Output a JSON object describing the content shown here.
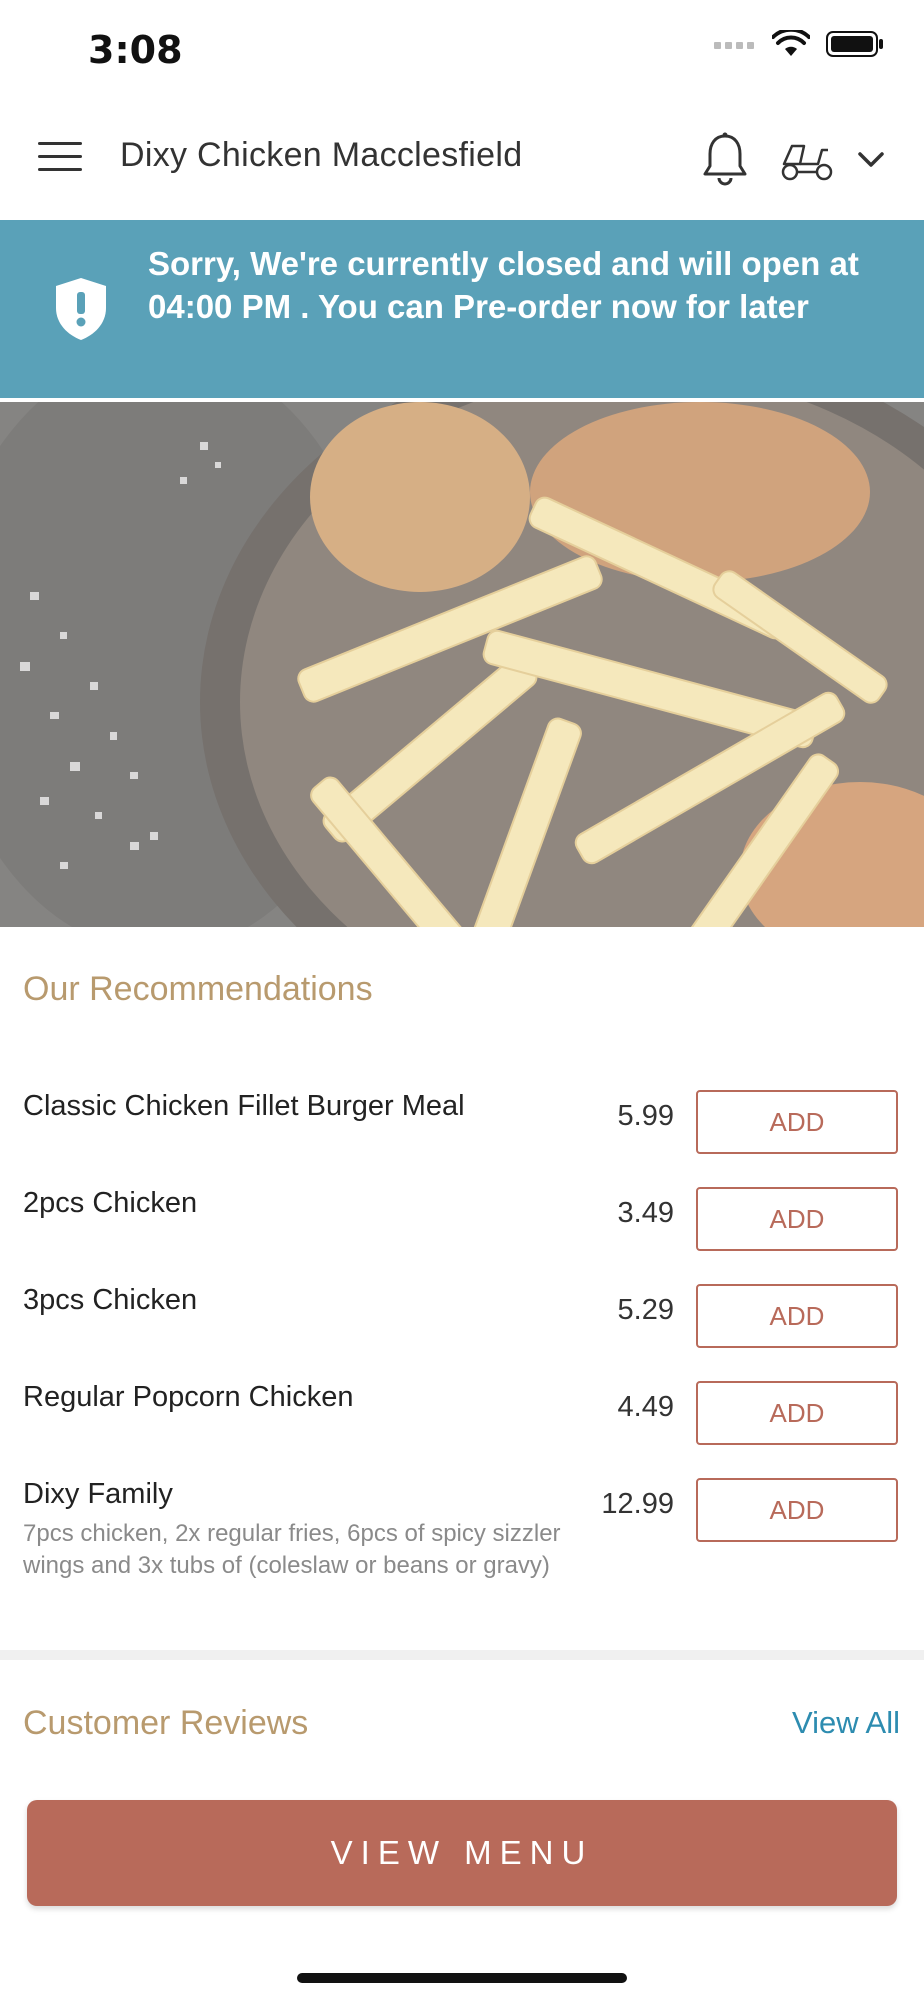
{
  "status_bar": {
    "time": "3:08"
  },
  "header": {
    "title": "Dixy Chicken Macclesfield"
  },
  "banner": {
    "message": "Sorry, We're currently closed and will open at 04:00 PM . You can Pre-order now for later"
  },
  "recommendations": {
    "title": "Our Recommendations",
    "add_label": "ADD",
    "items": [
      {
        "name": "Classic Chicken Fillet Burger Meal",
        "price": "5.99",
        "description": ""
      },
      {
        "name": "2pcs Chicken",
        "price": "3.49",
        "description": ""
      },
      {
        "name": "3pcs Chicken",
        "price": "5.29",
        "description": ""
      },
      {
        "name": "Regular Popcorn Chicken",
        "price": "4.49",
        "description": ""
      },
      {
        "name": "Dixy Family",
        "price": "12.99",
        "description": "7pcs chicken, 2x regular fries, 6pcs of spicy sizzler wings and 3x tubs of (coleslaw or beans or gravy)"
      }
    ]
  },
  "reviews": {
    "title": "Customer Reviews",
    "view_all_label": "View All"
  },
  "cta": {
    "view_menu_label": "VIEW MENU"
  },
  "colors": {
    "banner": "#5aa1b8",
    "accent": "#b86a5a",
    "section_title": "#b89a6e",
    "link": "#2d8cb0"
  },
  "icons": [
    "hamburger-menu-icon",
    "bell-icon",
    "delivery-scooter-icon",
    "chevron-down-icon",
    "shield-alert-icon"
  ]
}
